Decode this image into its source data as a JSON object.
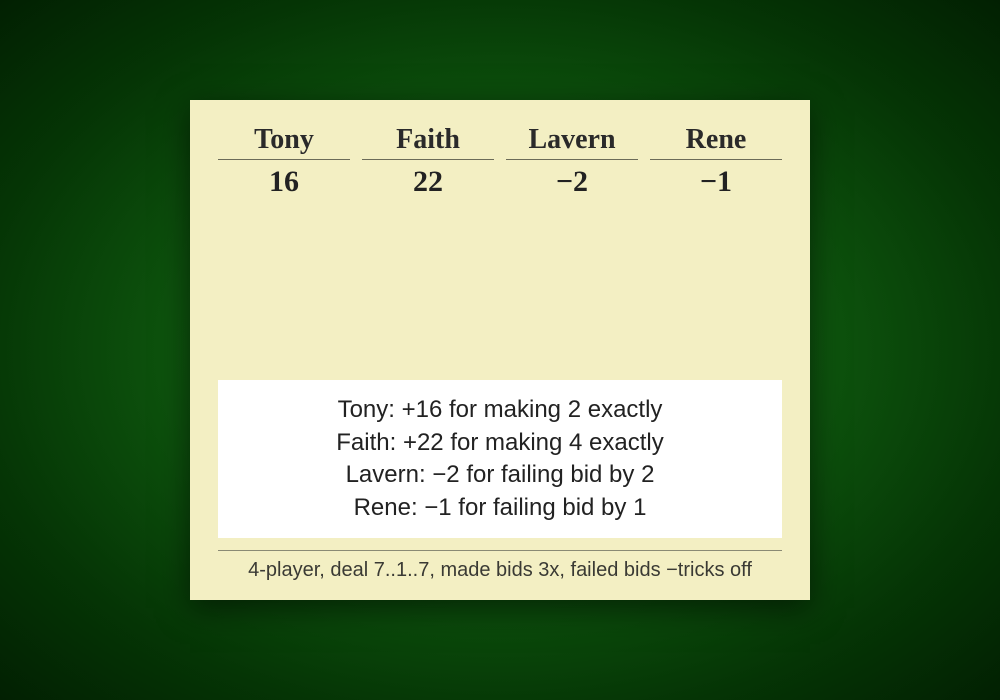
{
  "players": [
    {
      "name": "Tony",
      "score": "16"
    },
    {
      "name": "Faith",
      "score": "22"
    },
    {
      "name": "Lavern",
      "score": "−2"
    },
    {
      "name": "Rene",
      "score": "−1"
    }
  ],
  "log": [
    "Tony: +16 for making 2 exactly",
    "Faith: +22 for making 4 exactly",
    "Lavern: −2 for failing bid by 2",
    "Rene: −1 for failing bid by 1"
  ],
  "rules": "4-player, deal 7..1..7, made bids 3x, failed bids −tricks off"
}
